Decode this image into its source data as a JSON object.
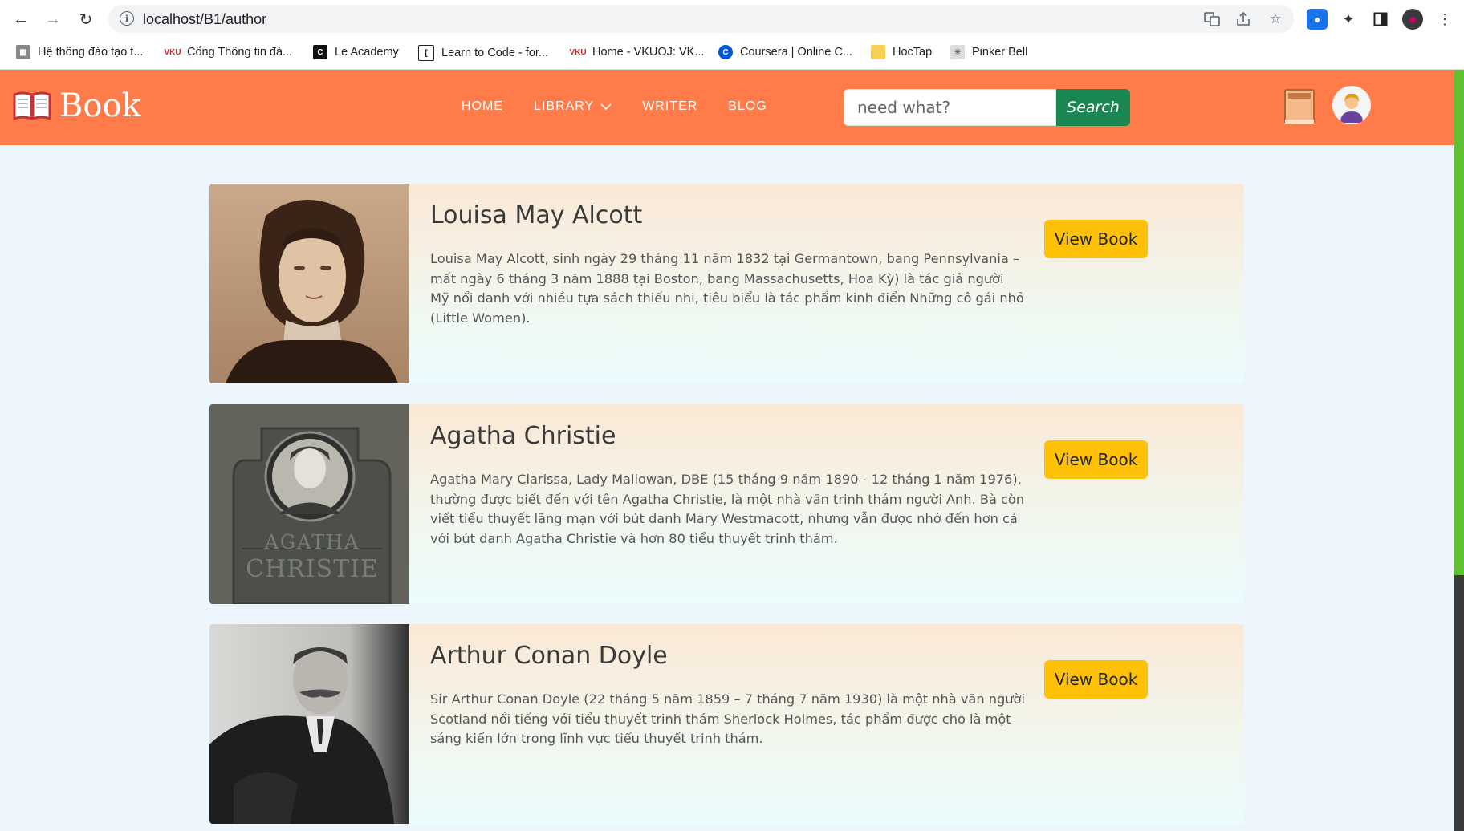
{
  "browser": {
    "url": "localhost/B1/author",
    "bookmarks": [
      {
        "label": "Hệ thống đào tạo t...",
        "icon": "training-system-icon"
      },
      {
        "label": "Cổng Thông tin đà...",
        "icon": "vku-icon"
      },
      {
        "label": "Le Academy",
        "icon": "le-academy-icon"
      },
      {
        "label": "Learn to Code - for...",
        "icon": "freecodecamp-icon"
      },
      {
        "label": "Home - VKUOJ: VK...",
        "icon": "vku-icon"
      },
      {
        "label": "Coursera | Online C...",
        "icon": "coursera-icon"
      },
      {
        "label": "HocTap",
        "icon": "folder-icon"
      },
      {
        "label": "Pinker Bell",
        "icon": "pinker-bell-icon"
      }
    ]
  },
  "header": {
    "logo_text": "Book",
    "nav": [
      {
        "label": "HOME"
      },
      {
        "label": "LIBRARY"
      },
      {
        "label": "WRITER"
      },
      {
        "label": "BLOG"
      }
    ],
    "search_placeholder": "need what?",
    "search_button": "Search"
  },
  "authors": [
    {
      "name": "Louisa May Alcott",
      "bio": "Louisa May Alcott, sinh ngày 29 tháng 11 năm 1832 tại Germantown, bang Pennsylvania – mất ngày 6 tháng 3 năm 1888 tại Boston, bang Massachusetts, Hoa Kỳ) là tác giả người Mỹ nổi danh với nhiều tựa sách thiếu nhi, tiêu biểu là tác phẩm kinh điển Những cô gái nhỏ (Little Women).",
      "button": "View Book"
    },
    {
      "name": "Agatha Christie",
      "bio": "Agatha Mary Clarissa, Lady Mallowan, DBE (15 tháng 9 năm 1890 - 12 tháng 1 năm 1976), thường được biết đến với tên Agatha Christie, là một nhà văn trinh thám người Anh. Bà còn viết tiểu thuyết lãng mạn với bút danh Mary Westmacott, nhưng vẫn được nhớ đến hơn cả với bút danh Agatha Christie và hơn 80 tiểu thuyết trinh thám.",
      "button": "View Book",
      "plaque_text": "AGATHA CHRISTIE"
    },
    {
      "name": "Arthur Conan Doyle",
      "bio": "Sir Arthur Conan Doyle (22 tháng 5 năm 1859 – 7 tháng 7 năm 1930) là một nhà văn người Scotland nổi tiếng với tiểu thuyết trinh thám Sherlock Holmes, tác phẩm được cho là một sáng kiến lớn trong lĩnh vực tiểu thuyết trinh thám.",
      "button": "View Book"
    }
  ]
}
